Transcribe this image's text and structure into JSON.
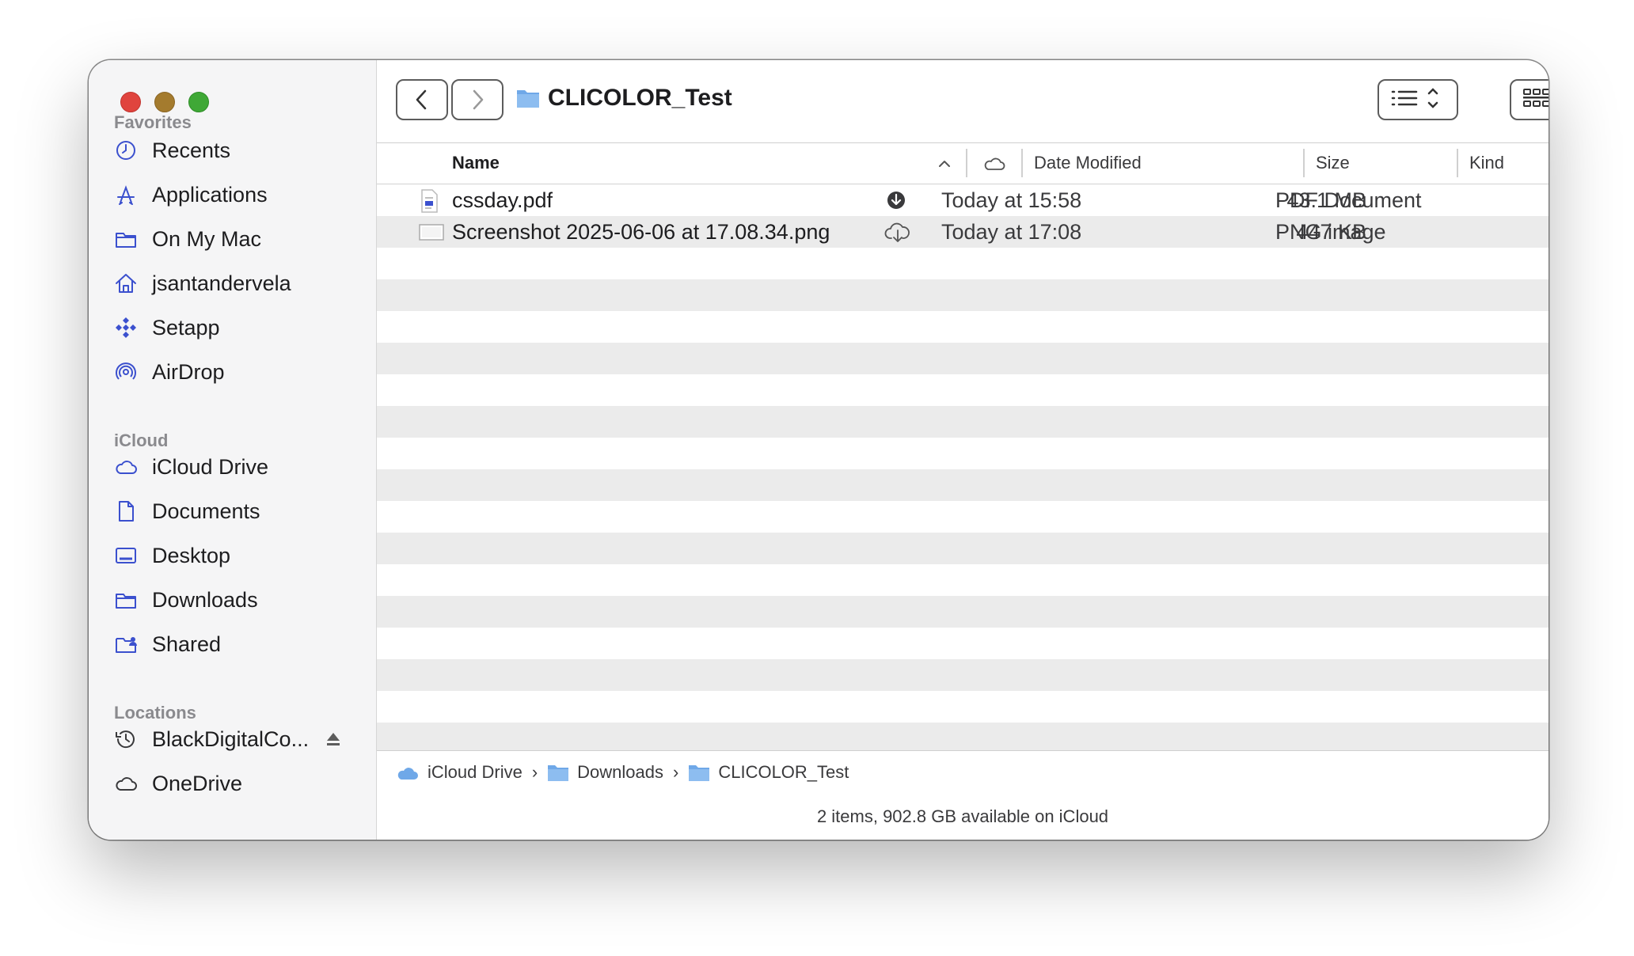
{
  "window": {
    "title": "CLICOLOR_Test"
  },
  "sidebar": {
    "favorites_label": "Favorites",
    "favorites": [
      {
        "label": "Recents",
        "icon": "clock-icon"
      },
      {
        "label": "Applications",
        "icon": "applications-icon"
      },
      {
        "label": "On My Mac",
        "icon": "folder-icon"
      },
      {
        "label": "jsantandervela",
        "icon": "home-icon"
      },
      {
        "label": "Setapp",
        "icon": "setapp-icon"
      },
      {
        "label": "AirDrop",
        "icon": "airdrop-icon"
      }
    ],
    "icloud_label": "iCloud",
    "icloud": [
      {
        "label": "iCloud Drive",
        "icon": "cloud-icon"
      },
      {
        "label": "Documents",
        "icon": "document-icon"
      },
      {
        "label": "Desktop",
        "icon": "desktop-icon"
      },
      {
        "label": "Downloads",
        "icon": "folder-icon"
      },
      {
        "label": "Shared",
        "icon": "shared-folder-icon"
      }
    ],
    "locations_label": "Locations",
    "locations": [
      {
        "label": "BlackDigitalCo...",
        "icon": "time-machine-icon"
      },
      {
        "label": "OneDrive",
        "icon": "cloud-icon"
      }
    ]
  },
  "columns": {
    "name": "Name",
    "date": "Date Modified",
    "size": "Size",
    "kind": "Kind"
  },
  "files": [
    {
      "name": "cssday.pdf",
      "date": "Today at 15:58",
      "size": "43.1 MB",
      "kind": "PDF Document",
      "icloud_status": "downloading-icon"
    },
    {
      "name": "Screenshot 2025-06-06 at 17.08.34.png",
      "date": "Today at 17:08",
      "size": "447 KB",
      "kind": "PNG image",
      "icloud_status": "cloud-download-icon"
    }
  ],
  "pathbar": [
    "iCloud Drive",
    "Downloads",
    "CLICOLOR_Test"
  ],
  "status": "2 items, 902.8 GB available on iCloud",
  "colors": {
    "accent": "#3b50ce",
    "folder": "#6fa8e8",
    "row_alt": "#ebebeb"
  }
}
